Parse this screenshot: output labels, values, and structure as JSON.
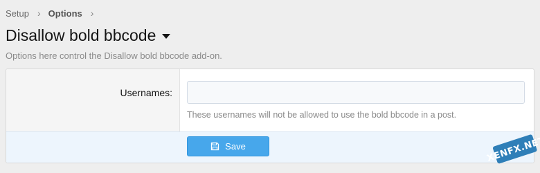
{
  "breadcrumb": {
    "items": [
      "Setup",
      "Options"
    ],
    "separator": "›"
  },
  "page": {
    "title": "Disallow bold bbcode",
    "description": "Options here control the Disallow bold bbcode add-on."
  },
  "form": {
    "usernames_label": "Usernames:",
    "usernames_value": "",
    "usernames_explain": "These usernames will not be allowed to use the bold bbcode in a post.",
    "save_label": "Save"
  },
  "watermark": {
    "text": "XENFX.NET"
  },
  "colors": {
    "accent": "#47a7eb",
    "submit_bg": "#edf5fd",
    "label_bg": "#f5f5f5"
  }
}
